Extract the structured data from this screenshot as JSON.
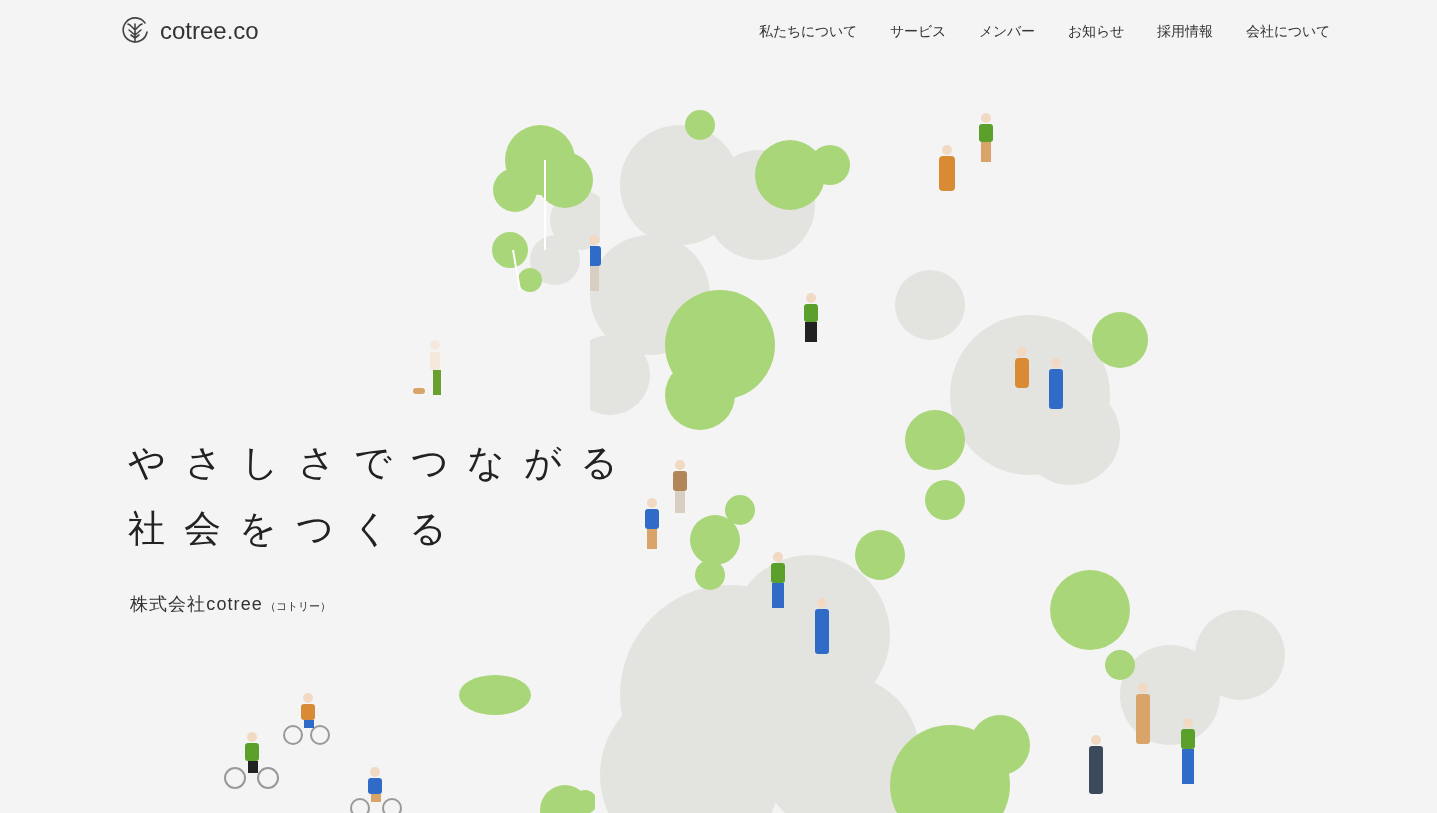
{
  "header": {
    "logo_text": "cotree.co",
    "nav": [
      "私たちについて",
      "サービス",
      "メンバー",
      "お知らせ",
      "採用情報",
      "会社について"
    ]
  },
  "hero": {
    "headline": [
      "やさしさでつながる",
      "社会をつくる"
    ],
    "company_name": "株式会社cotree",
    "company_reading": "（コトリー）"
  }
}
